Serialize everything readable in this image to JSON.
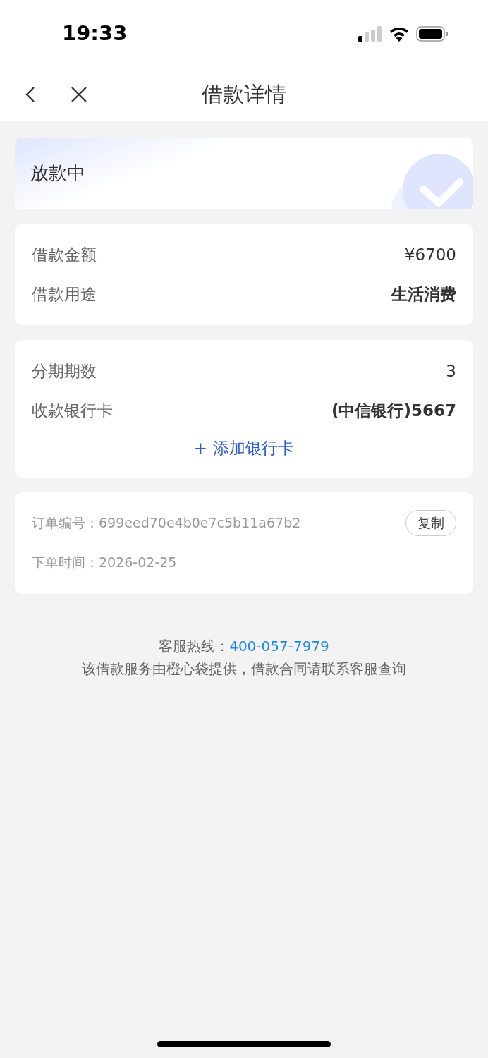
{
  "status_bar": {
    "time": "19:33"
  },
  "nav": {
    "title": "借款详情"
  },
  "status_card": {
    "title": "放款中"
  },
  "loan_card": {
    "rows": [
      {
        "label": "借款金额",
        "value": "¥6700",
        "bold": false
      },
      {
        "label": "借款用途",
        "value": "生活消费",
        "bold": true
      }
    ]
  },
  "plan_card": {
    "rows": [
      {
        "label": "分期期数",
        "value": "3",
        "bold": false
      },
      {
        "label": "收款银行卡",
        "value": "(中信银行)5667",
        "bold": true
      }
    ],
    "add_button": {
      "icon": "+",
      "label": "添加银行卡"
    }
  },
  "order_card": {
    "rows": [
      {
        "label": "订单编号：",
        "value": "699eed70e4b0e7c5b11a67b2"
      },
      {
        "label": "下单时间：",
        "value": "2026-02-25"
      }
    ],
    "copy_button": "复制"
  },
  "footer": {
    "hotline_label": "客服热线：",
    "hotline": "400-057-7979",
    "note": "该借款服务由橙心袋提供，借款合同请联系客服查询"
  }
}
